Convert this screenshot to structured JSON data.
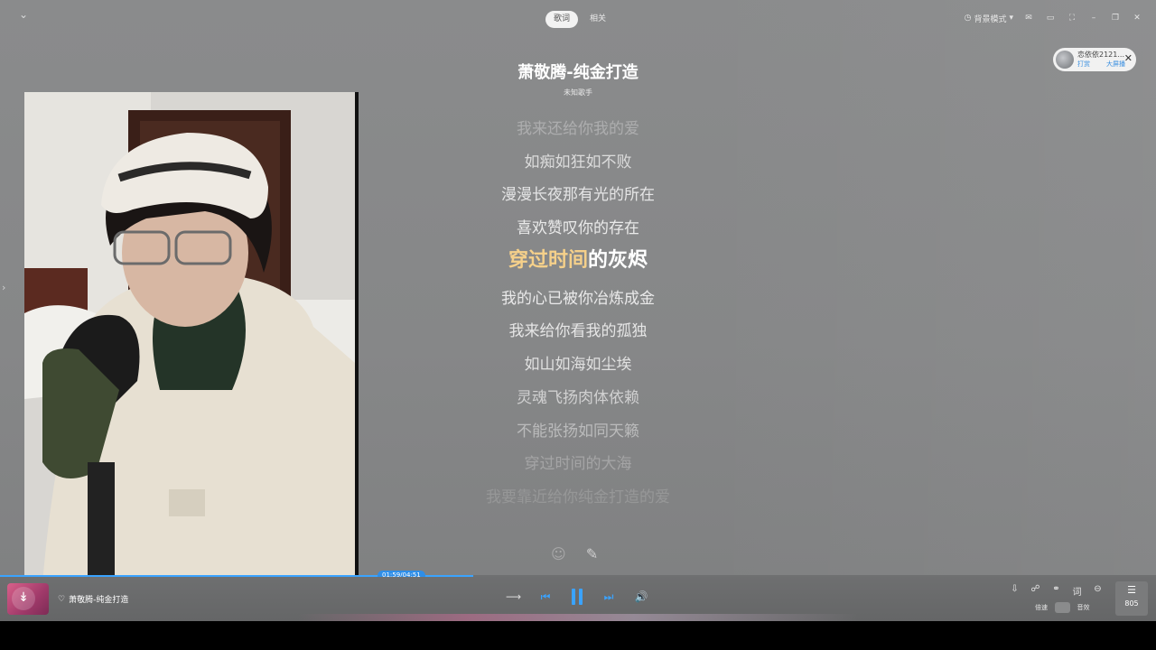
{
  "top": {
    "tabs": [
      {
        "label": "歌词",
        "active": true
      },
      {
        "label": "相关",
        "active": false
      }
    ],
    "mode_label": "背景模式",
    "icons": [
      "mode-icon",
      "mail-icon",
      "desktop-icon",
      "fullscreen-icon",
      "minimize-icon",
      "restore-icon",
      "close-icon"
    ]
  },
  "user": {
    "name": "恋依依2121...",
    "link_left": "打赏",
    "link_right": "大屏播"
  },
  "song": {
    "title": "萧敬腾-纯金打造",
    "artist": "未知歌手"
  },
  "lyrics": {
    "lines": [
      {
        "text": "我来还给你我的爱",
        "opacity": 0.35
      },
      {
        "text": "如痴如狂如不败",
        "opacity": 0.8
      },
      {
        "text": "漫漫长夜那有光的所在",
        "opacity": 0.9
      },
      {
        "text": "喜欢赞叹你的存在",
        "opacity": 0.95
      },
      {
        "text": "",
        "opacity": 1
      },
      {
        "text": "我的心已被你冶炼成金",
        "opacity": 0.95
      },
      {
        "text": "我来给你看我的孤独",
        "opacity": 0.9
      },
      {
        "text": "如山如海如尘埃",
        "opacity": 0.85
      },
      {
        "text": "灵魂飞扬肉体依赖",
        "opacity": 0.7
      },
      {
        "text": "不能张扬如同天籁",
        "opacity": 0.5
      },
      {
        "text": "穿过时间的大海",
        "opacity": 0.3
      },
      {
        "text": "我要靠近给你纯金打造的爱",
        "opacity": 0.18
      }
    ],
    "active_sung": "穿过时间",
    "active_rest": "的灰烬"
  },
  "progress": {
    "time": "01:59/04:51",
    "fraction": 0.409
  },
  "player": {
    "now_playing": "萧敬腾-纯金打造",
    "labels": [
      "倍速",
      "音效"
    ],
    "playlist_count": "805"
  },
  "colors": {
    "accent": "#3aa3ff",
    "lyric_highlight": "#f5d08a"
  }
}
